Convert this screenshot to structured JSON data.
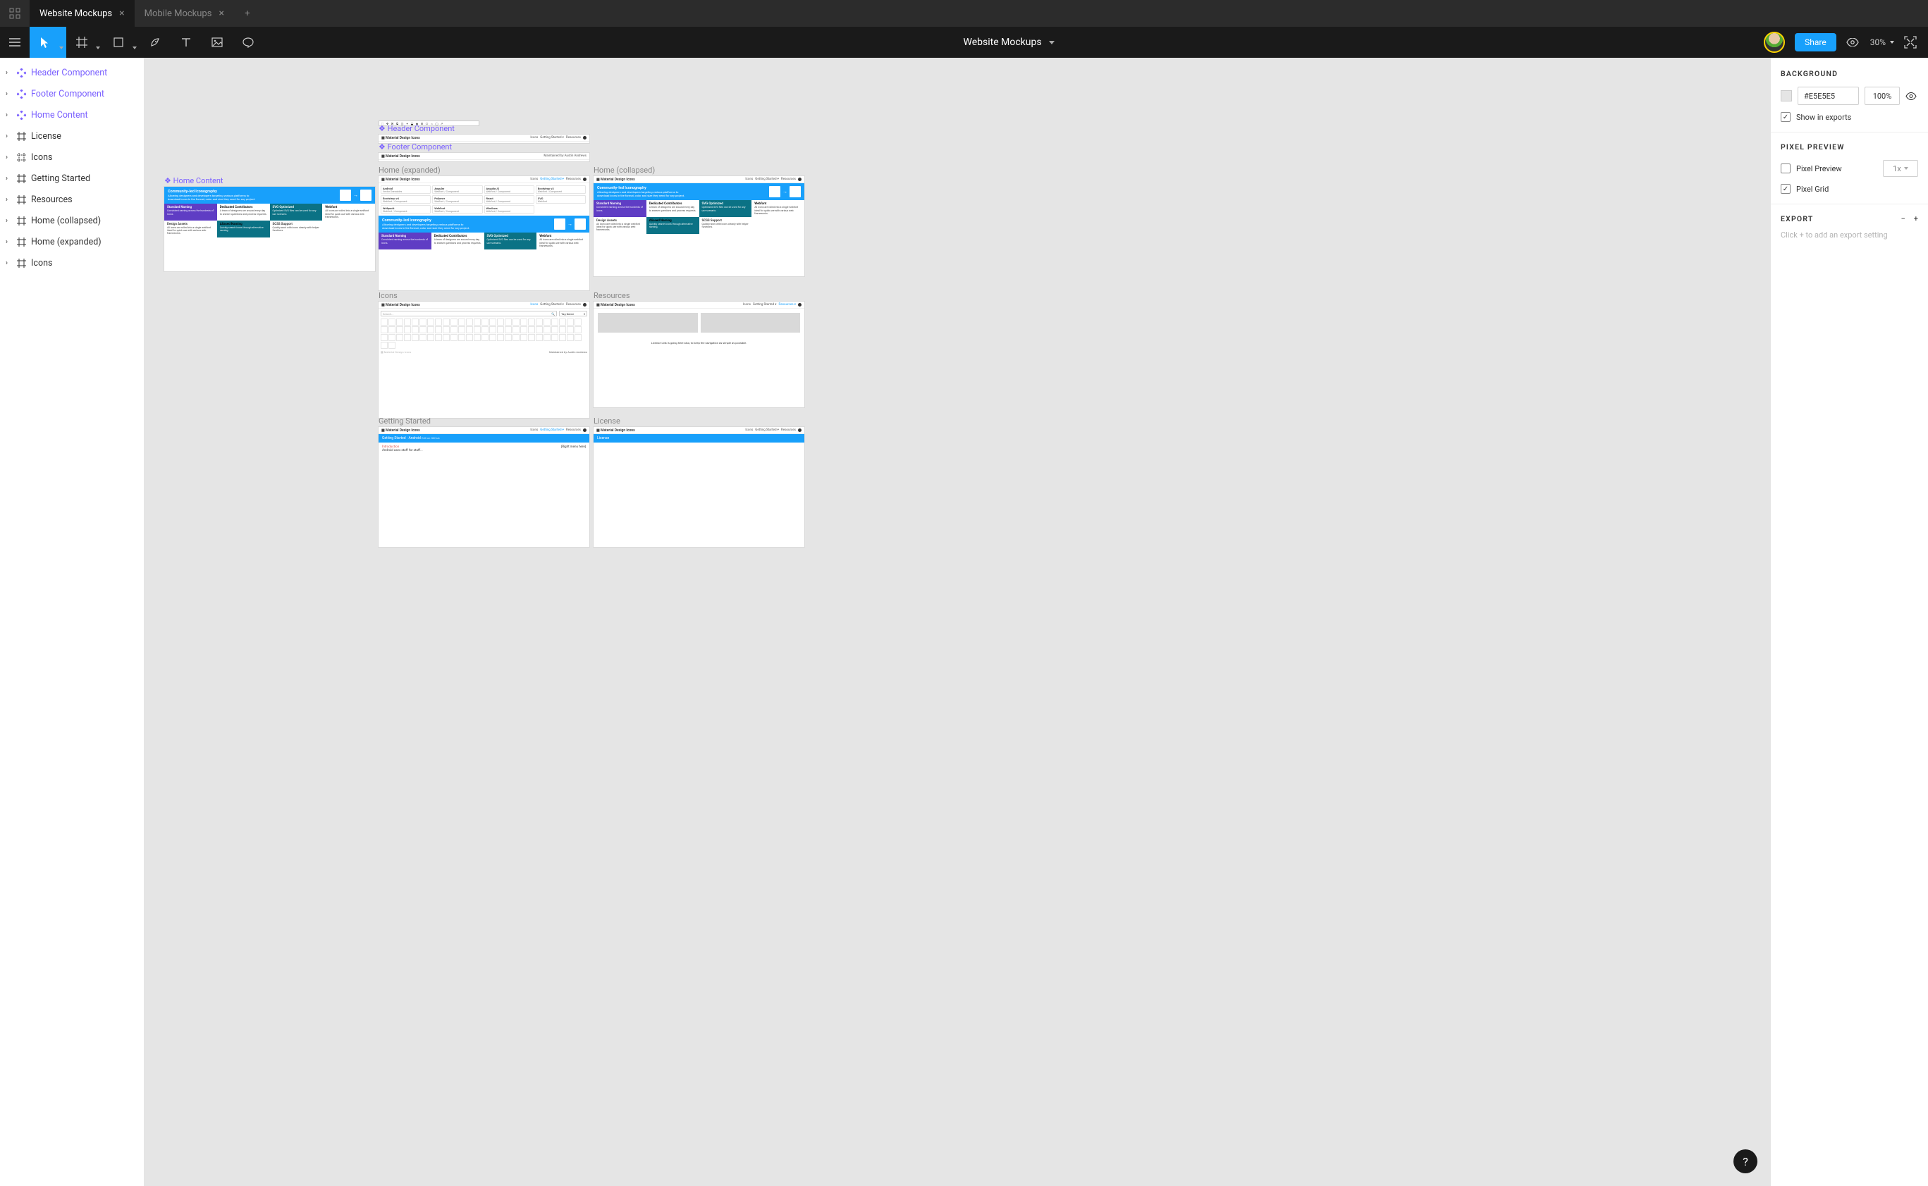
{
  "tabs": [
    {
      "label": "Website Mockups",
      "active": true
    },
    {
      "label": "Mobile Mockups",
      "active": false
    }
  ],
  "document": {
    "title": "Website Mockups"
  },
  "toolbar": {
    "share_label": "Share",
    "zoom_label": "30%"
  },
  "layers": [
    {
      "name": "Header Component",
      "kind": "component"
    },
    {
      "name": "Footer Component",
      "kind": "component"
    },
    {
      "name": "Home Content",
      "kind": "component"
    },
    {
      "name": "License",
      "kind": "frame"
    },
    {
      "name": "Icons",
      "kind": "frame"
    },
    {
      "name": "Getting Started",
      "kind": "frame"
    },
    {
      "name": "Resources",
      "kind": "frame"
    },
    {
      "name": "Home (collapsed)",
      "kind": "frame"
    },
    {
      "name": "Home (expanded)",
      "kind": "frame"
    },
    {
      "name": "Icons",
      "kind": "frame"
    }
  ],
  "inspector": {
    "background": {
      "title": "BACKGROUND",
      "color_hex": "#E5E5E5",
      "opacity": "100%",
      "show_in_exports_label": "Show in exports",
      "show_in_exports_checked": true
    },
    "pixel_preview": {
      "title": "PIXEL PREVIEW",
      "preview_label": "Pixel Preview",
      "preview_checked": false,
      "scale_label": "1x",
      "grid_label": "Pixel Grid",
      "grid_checked": true
    },
    "export": {
      "title": "EXPORT",
      "hint": "Click + to add an export setting"
    }
  },
  "canvas": {
    "frames": {
      "header_component": {
        "label": "Header Component"
      },
      "footer_component": {
        "label": "Footer Component"
      },
      "home_content": {
        "label": "Home Content"
      },
      "home_expanded": {
        "label": "Home (expanded)"
      },
      "home_collapsed": {
        "label": "Home (collapsed)"
      },
      "icons_top": {
        "label": "Icons"
      },
      "resources": {
        "label": "Resources"
      },
      "getting_started": {
        "label": "Getting Started"
      },
      "license": {
        "label": "License"
      }
    },
    "mdi": {
      "brand": "Material Design Icons",
      "brand_dim": "Material Design Icons",
      "nav": {
        "icons": "Icons",
        "getting_started": "Getting Started",
        "getting_started_caret": "Getting Started ▾",
        "resources": "Resources",
        "resources_caret": "Resources ▾"
      },
      "hero": {
        "title": "Community-led Iconography",
        "subtitle": "Allowing designers and developers targeting various platforms to download icons in the format, color and size they need for any project."
      },
      "features": {
        "a": {
          "t": "Standard Naming",
          "d": "Consistent naming across the hundreds of icons."
        },
        "b": {
          "t": "Dedicated Contributors",
          "d": "A team of designers are around every day to answer questions and process requests."
        },
        "c": {
          "t": "SVG Optimized",
          "d": "Optimized SVG files can be used for any use scenario."
        },
        "d": {
          "t": "Webfont",
          "d": "All icons are rolled into a single webfont ideal for quick use with various web frameworks."
        },
        "e": {
          "t": "Design Assets",
          "d": "All icons are rolled into a single webfont ideal for quick use with various web frameworks."
        },
        "f": {
          "t": "Aliased Naming",
          "d": "Quickly search icons through alternative naming."
        },
        "g": {
          "t": "SCSS Support",
          "d": "Quickly work with icons cleanly with helper functions."
        }
      },
      "platform_cards": [
        {
          "t": "Android",
          "d": "Vector Drawables"
        },
        {
          "t": "Angular",
          "d": "Webfont / Component"
        },
        {
          "t": "AngularJS",
          "d": "Webfont / Component"
        },
        {
          "t": "Bootstrap v3",
          "d": "Webfont / Component"
        },
        {
          "t": "Bootstrap v4",
          "d": "Webfont / Component"
        },
        {
          "t": "Polymer",
          "d": "Webfont / Component"
        },
        {
          "t": "React",
          "d": "Webfont / Component"
        },
        {
          "t": "SVG",
          "d": "Webfont"
        },
        {
          "t": "Webpack",
          "d": "Webfont / Component"
        },
        {
          "t": "Webfont",
          "d": "Webfont / Component"
        },
        {
          "t": "Windows",
          "d": "Webfont / Component"
        }
      ],
      "footer_author": "Maintained by Austin Andrews",
      "icons_page": {
        "search_placeholder": "Search...",
        "tag_label": "Tag Name"
      },
      "resources_note": "License Link is going here also, to keep the navigation as simple as possible.",
      "getting_started_page": {
        "title": "Getting Started - Android",
        "edit": "Edit on GitHub",
        "intro_label": "Introduction",
        "intro_body": "Android uses stuff for stuff...",
        "right_menu": "[Right menu here]"
      },
      "license_page": {
        "title": "License"
      }
    }
  }
}
